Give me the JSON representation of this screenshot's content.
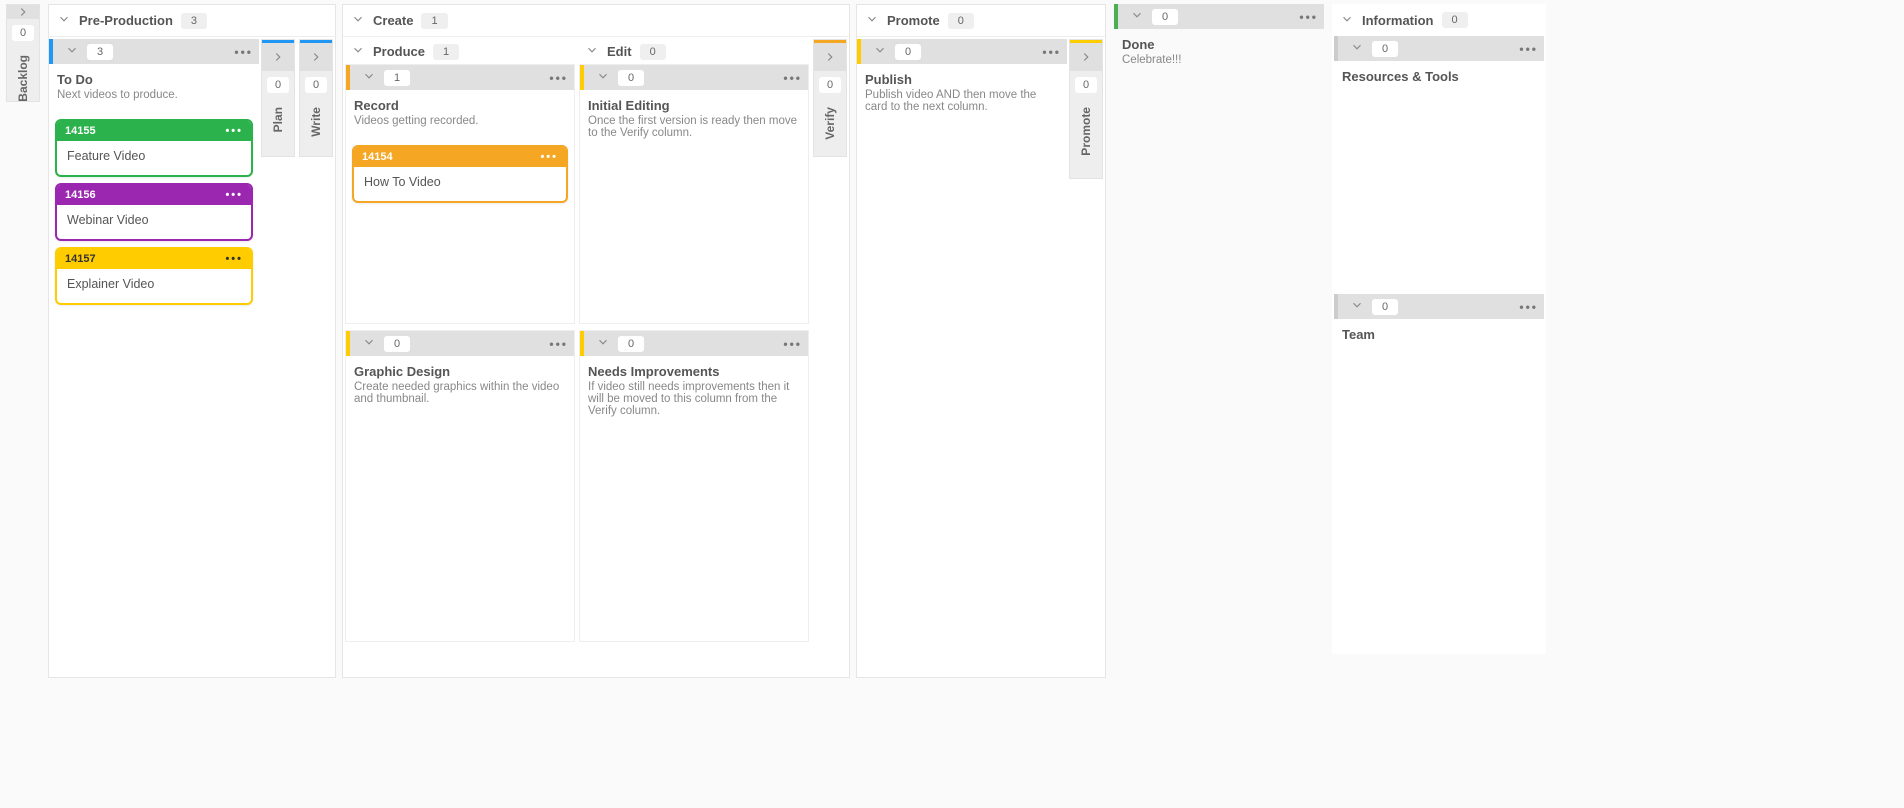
{
  "colors": {
    "blue": "#2196f3",
    "green": "#2bb24c",
    "purple": "#9b27b0",
    "yellow": "#ffcc00",
    "orange": "#f5a623",
    "grey": "#cccccc",
    "limeStripe": "#4caf50"
  },
  "backlog": {
    "title": "Backlog",
    "count": "0"
  },
  "groups": {
    "pre": {
      "title": "Pre-Production",
      "count": "3"
    },
    "create": {
      "title": "Create",
      "count": "1"
    },
    "promote": {
      "title": "Promote",
      "count": "0"
    },
    "info": {
      "title": "Information",
      "count": "0"
    }
  },
  "lanes": {
    "todo": {
      "count": "3",
      "title": "To Do",
      "desc": "Next videos to produce."
    },
    "plan": {
      "title": "Plan",
      "count": "0"
    },
    "write": {
      "title": "Write",
      "count": "0"
    },
    "produce": {
      "count": "1",
      "title": "Produce"
    },
    "record": {
      "count": "1",
      "title": "Record",
      "desc": "Videos getting recorded."
    },
    "graphic": {
      "count": "0",
      "title": "Graphic Design",
      "desc": "Create needed graphics within the video and thumbnail."
    },
    "edit": {
      "count": "0",
      "title": "Edit"
    },
    "initial": {
      "count": "0",
      "title": "Initial Editing",
      "desc": "Once the first version is ready then move to the Verify column."
    },
    "improve": {
      "count": "0",
      "title": "Needs Improvements",
      "desc": "If video still needs improvements then it will be moved to this column from the Verify column."
    },
    "verify": {
      "title": "Verify",
      "count": "0"
    },
    "publish": {
      "count": "0",
      "title": "Publish",
      "desc": "Publish video AND then move the card to the next column."
    },
    "promoteV": {
      "title": "Promote",
      "count": "0"
    },
    "done": {
      "count": "0",
      "title": "Done",
      "desc": "Celebrate!!!"
    },
    "resources": {
      "count": "0",
      "title": "Resources & Tools"
    },
    "team": {
      "count": "0",
      "title": "Team"
    }
  },
  "cards": {
    "c1": {
      "id": "14155",
      "title": "Feature Video"
    },
    "c2": {
      "id": "14156",
      "title": "Webinar Video"
    },
    "c3": {
      "id": "14157",
      "title": "Explainer Video"
    },
    "c4": {
      "id": "14154",
      "title": "How To Video"
    }
  }
}
